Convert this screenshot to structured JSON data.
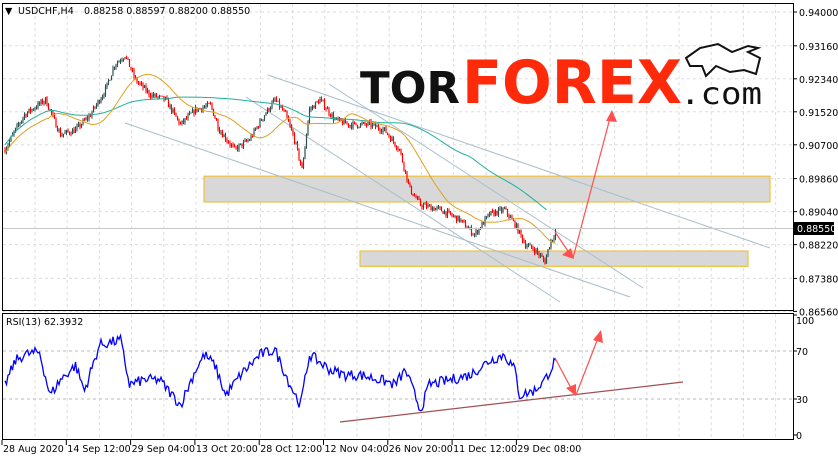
{
  "header": {
    "symbol_label": "USDCHF,H4",
    "ohlc_label": "0.88258 0.88597 0.88200 0.88550"
  },
  "logo": {
    "part1": "TOR",
    "part2": "FOREX",
    "part3": ".com"
  },
  "colors": {
    "up": "#2f4f4f",
    "down": "#ff0000",
    "ma_fast": "#e0a020",
    "ma_slow": "#20b0a0",
    "rsi": "#0000ff",
    "zone_border": "#f0c040",
    "arrow": "#ff5050",
    "trendline": "#a8bfcc",
    "rsi_trend": "#a05050"
  },
  "chart_data": [
    {
      "type": "candlestick",
      "title": "USDCHF,H4",
      "price_axis_ticks": [
        "0.94000",
        "0.93160",
        "0.92340",
        "0.91520",
        "0.90700",
        "0.89860",
        "0.89040",
        "0.88220",
        "0.87380",
        "0.86560"
      ],
      "ylim": [
        0.8656,
        0.94
      ],
      "current_price_label": "0.88550",
      "x_tick_labels": [
        "28 Aug 2020",
        "14 Sep 12:00",
        "29 Sep 04:00",
        "13 Oct 20:00",
        "28 Oct 12:00",
        "12 Nov 04:00",
        "26 Nov 20:00",
        "11 Dec 12:00",
        "29 Dec 08:00"
      ],
      "bar_count": 368,
      "close_keypoints": [
        [
          0,
          0.9058
        ],
        [
          7,
          0.9107
        ],
        [
          13,
          0.9145
        ],
        [
          27,
          0.9182
        ],
        [
          37,
          0.9095
        ],
        [
          47,
          0.9107
        ],
        [
          57,
          0.9145
        ],
        [
          67,
          0.9207
        ],
        [
          73,
          0.9269
        ],
        [
          80,
          0.9293
        ],
        [
          87,
          0.9231
        ],
        [
          97,
          0.9194
        ],
        [
          107,
          0.9182
        ],
        [
          117,
          0.912
        ],
        [
          127,
          0.9157
        ],
        [
          137,
          0.9169
        ],
        [
          143,
          0.9107
        ],
        [
          153,
          0.9058
        ],
        [
          163,
          0.9083
        ],
        [
          173,
          0.9145
        ],
        [
          180,
          0.9182
        ],
        [
          187,
          0.9145
        ],
        [
          193,
          0.9083
        ],
        [
          198,
          0.9008
        ],
        [
          203,
          0.9157
        ],
        [
          210,
          0.9182
        ],
        [
          220,
          0.9132
        ],
        [
          230,
          0.912
        ],
        [
          243,
          0.912
        ],
        [
          253,
          0.9107
        ],
        [
          263,
          0.9058
        ],
        [
          270,
          0.8959
        ],
        [
          277,
          0.8921
        ],
        [
          290,
          0.8909
        ],
        [
          303,
          0.8884
        ],
        [
          313,
          0.8847
        ],
        [
          323,
          0.8897
        ],
        [
          333,
          0.8909
        ],
        [
          340,
          0.8872
        ],
        [
          347,
          0.8822
        ],
        [
          353,
          0.881
        ],
        [
          360,
          0.878
        ],
        [
          363,
          0.8822
        ],
        [
          367,
          0.8855
        ]
      ],
      "zones": [
        {
          "from": 0.8928,
          "to": 0.8992
        },
        {
          "from": 0.8768,
          "to": 0.8806
        }
      ]
    },
    {
      "type": "line",
      "title": "RSI(13) 62.3932",
      "indicator_label": "RSI(13) 62.3932",
      "ylim": [
        0,
        100
      ],
      "y_tick_labels": [
        "100",
        "70",
        "30",
        "0"
      ],
      "levels": [
        70,
        30
      ],
      "rsi_keypoints": [
        [
          0,
          42
        ],
        [
          7,
          62
        ],
        [
          13,
          67
        ],
        [
          23,
          69
        ],
        [
          30,
          33
        ],
        [
          37,
          46
        ],
        [
          47,
          58
        ],
        [
          53,
          37
        ],
        [
          63,
          75
        ],
        [
          77,
          79
        ],
        [
          83,
          42
        ],
        [
          93,
          46
        ],
        [
          103,
          46
        ],
        [
          117,
          25
        ],
        [
          127,
          54
        ],
        [
          133,
          67
        ],
        [
          140,
          58
        ],
        [
          147,
          33
        ],
        [
          157,
          50
        ],
        [
          170,
          67
        ],
        [
          180,
          71
        ],
        [
          190,
          42
        ],
        [
          197,
          25
        ],
        [
          203,
          67
        ],
        [
          217,
          54
        ],
        [
          227,
          50
        ],
        [
          237,
          50
        ],
        [
          250,
          46
        ],
        [
          260,
          42
        ],
        [
          267,
          54
        ],
        [
          277,
          21
        ],
        [
          283,
          42
        ],
        [
          297,
          46
        ],
        [
          310,
          50
        ],
        [
          323,
          62
        ],
        [
          333,
          67
        ],
        [
          340,
          54
        ],
        [
          343,
          33
        ],
        [
          353,
          37
        ],
        [
          360,
          46
        ],
        [
          367,
          62.4
        ]
      ]
    }
  ]
}
